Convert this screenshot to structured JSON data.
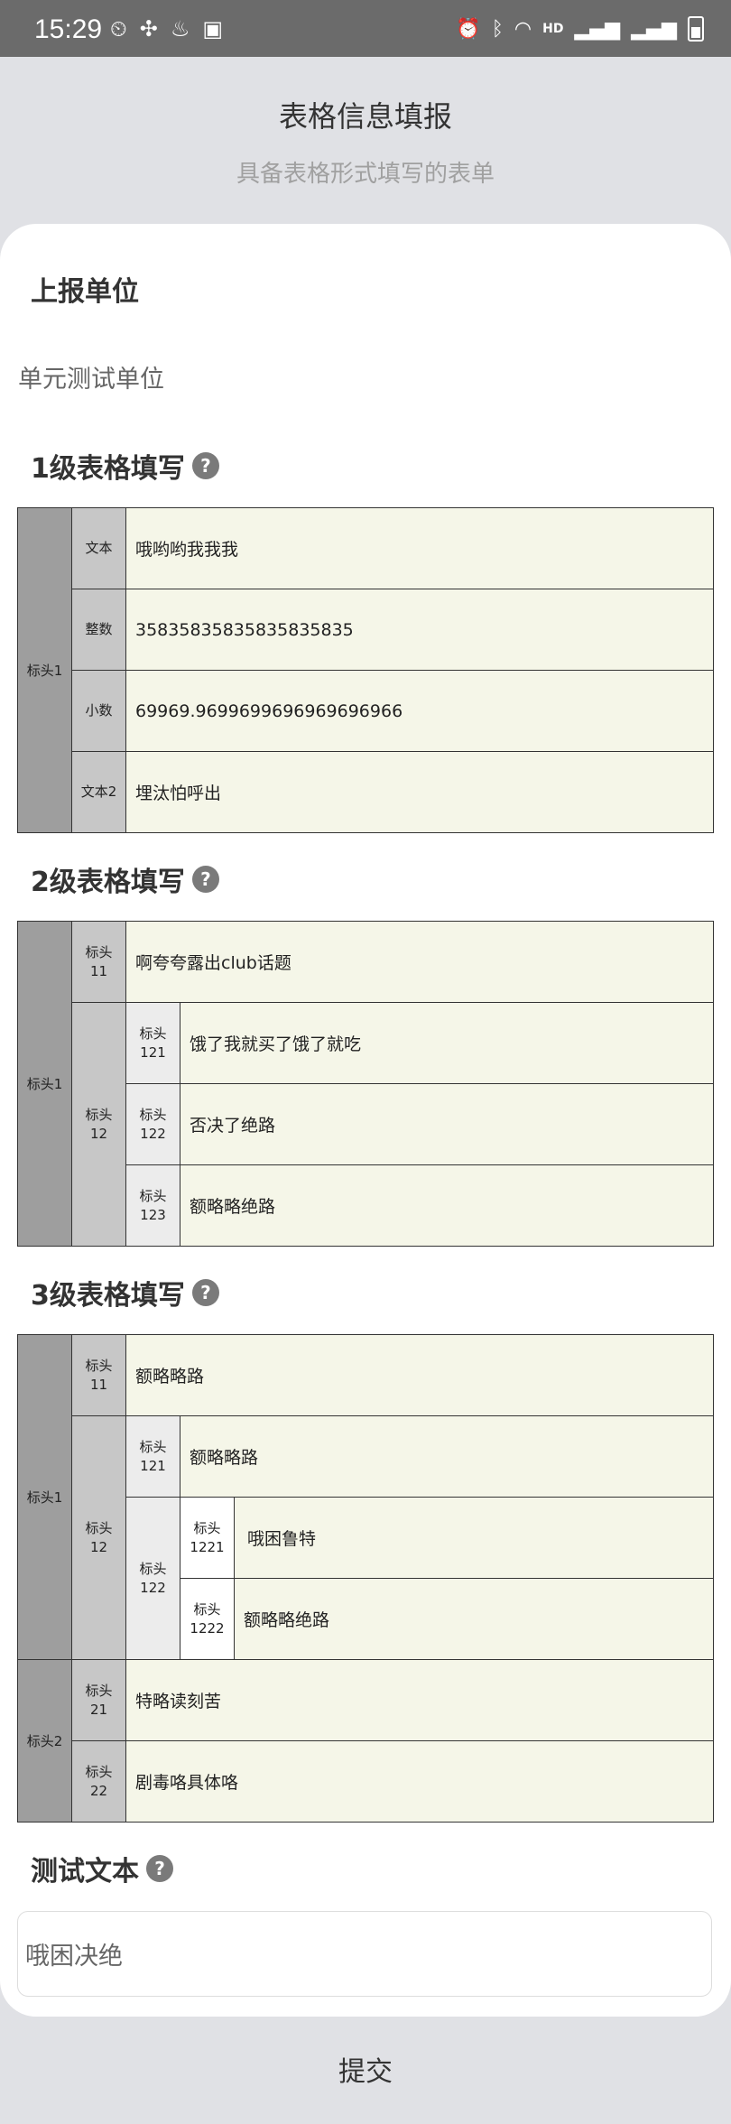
{
  "status": {
    "time": "15:29",
    "network_label": "HD"
  },
  "header": {
    "title": "表格信息填报",
    "subtitle": "具备表格形式填写的表单"
  },
  "unit_section": {
    "title": "上报单位",
    "value": "单元测试单位"
  },
  "table1": {
    "title": "1级表格填写",
    "head": "标头1",
    "rows": [
      {
        "label": "文本",
        "value": "哦哟哟我我我"
      },
      {
        "label": "整数",
        "value": "35835835835835835835"
      },
      {
        "label": "小数",
        "value": "69969.9699699696969696966"
      },
      {
        "label": "文本2",
        "value": "埋汰怕呼出"
      }
    ]
  },
  "table2": {
    "title": "2级表格填写",
    "head": "标头1",
    "h11": "标头\n11",
    "v11": "啊夸夸露出club话题",
    "h12": "标头\n12",
    "h121": "标头\n121",
    "v121": "饿了我就买了饿了就吃",
    "h122": "标头\n122",
    "v122": "否决了绝路",
    "h123": "标头\n123",
    "v123": "额略略绝路"
  },
  "table3": {
    "title": "3级表格填写",
    "head1": "标头1",
    "h11": "标头\n11",
    "v11": "额略略路",
    "h12": "标头\n12",
    "h121": "标头\n121",
    "v121": "额略略路",
    "h122": "标头\n122",
    "h1221": "标头\n1221",
    "v1221": "哦困鲁特",
    "h1222": "标头\n1222",
    "v1222": "额略略绝路",
    "head2": "标头2",
    "h21": "标头\n21",
    "v21": "特略读刻苦",
    "h22": "标头\n22",
    "v22": "剧毒咯具体咯"
  },
  "text_section": {
    "title": "测试文本",
    "value": "哦困决绝"
  },
  "submit_label": "提交"
}
